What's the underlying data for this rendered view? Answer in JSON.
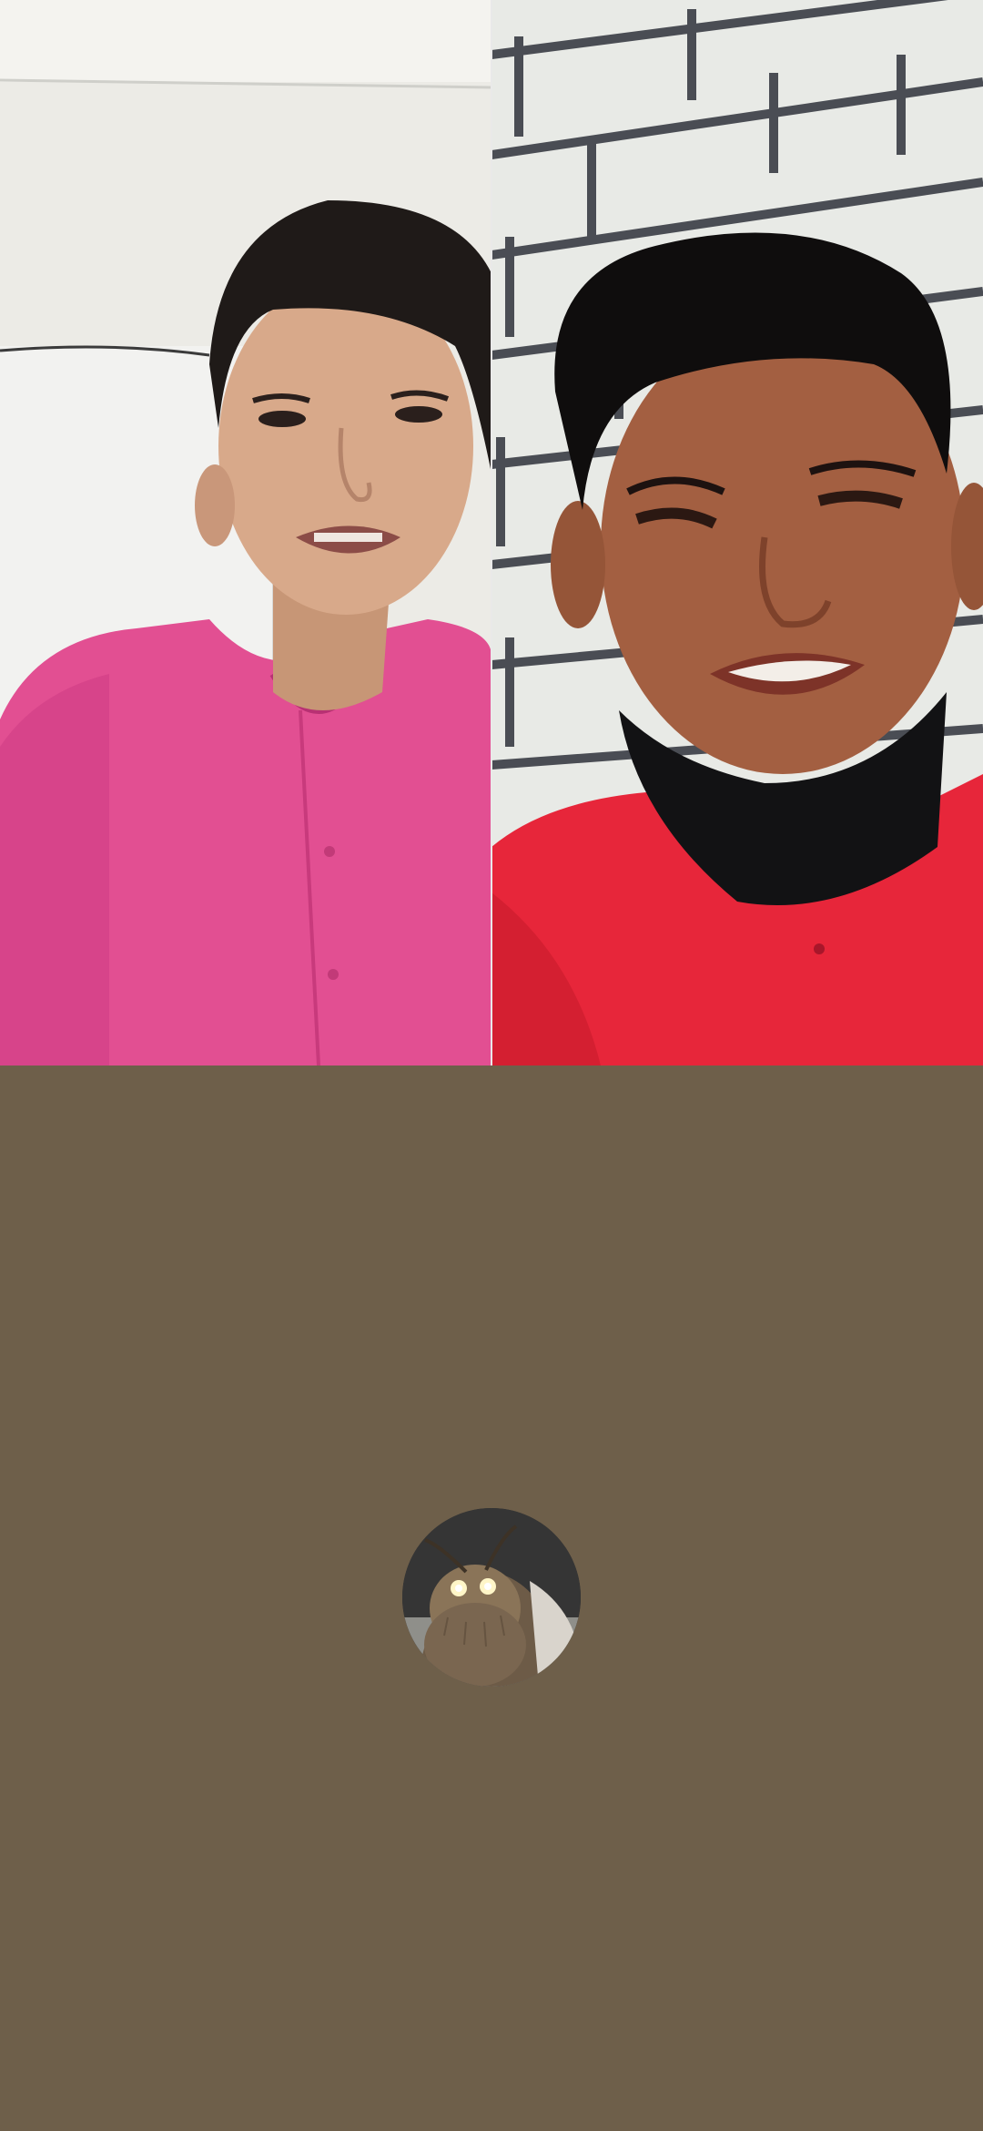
{
  "call": {
    "participants": [
      {
        "id": "participant-1",
        "video_on": true
      },
      {
        "id": "participant-2",
        "video_on": true
      },
      {
        "id": "self",
        "video_on": false,
        "avatar_icon": "moth-avatar-icon"
      }
    ],
    "colors": {
      "self_tile_background": "#6e5f4a",
      "divider": "#e9e9e9"
    }
  }
}
